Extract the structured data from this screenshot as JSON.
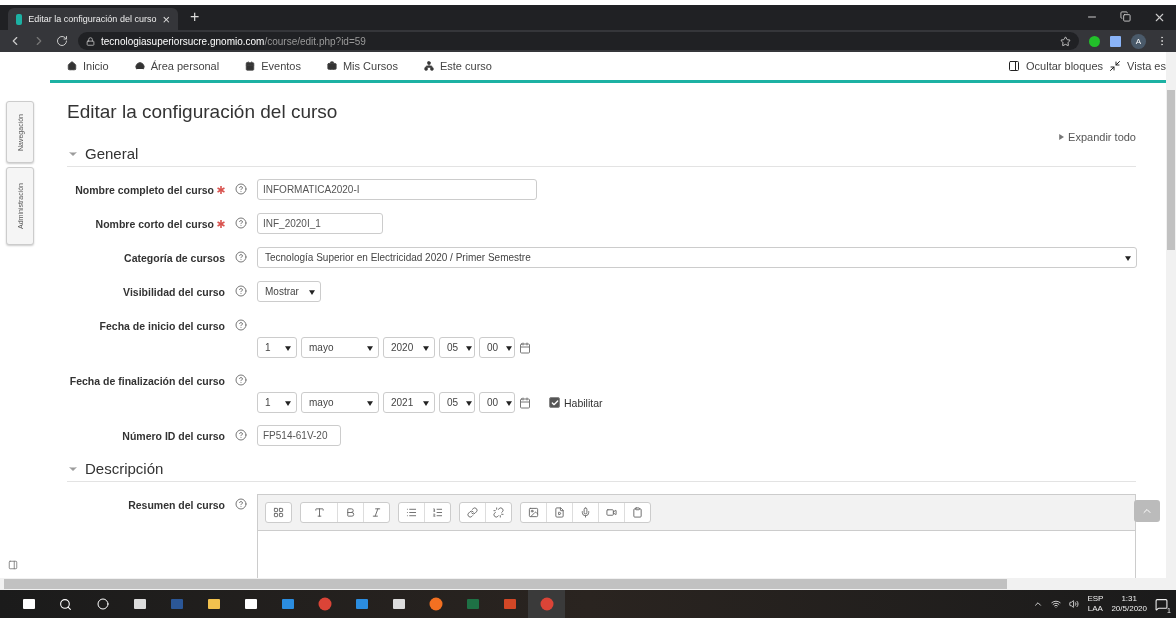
{
  "browser": {
    "tab_title": "Editar la configuración del curso",
    "tab_close": "×",
    "new_tab": "+",
    "host": "tecnologiasuperiorsucre.gnomio.com",
    "path": "/course/edit.php?id=59",
    "profile": "A"
  },
  "nav": {
    "items": [
      {
        "label": "Inicio"
      },
      {
        "label": "Área personal"
      },
      {
        "label": "Eventos"
      },
      {
        "label": "Mis Cursos"
      },
      {
        "label": "Este curso"
      }
    ],
    "right": [
      {
        "label": "Ocultar bloques"
      },
      {
        "label": "Vista es"
      }
    ]
  },
  "side_blocks": [
    "Navegación",
    "Administración"
  ],
  "page_title": "Editar la configuración del curso",
  "expand_all": "Expandir todo",
  "sections": [
    {
      "title": "General",
      "expanded": true,
      "fields": [
        {
          "kind": "text",
          "label": "Nombre completo del curso",
          "required": true,
          "value": "INFORMATICA2020-I"
        },
        {
          "kind": "text",
          "label": "Nombre corto del curso",
          "required": true,
          "value": "INF_2020I_1"
        },
        {
          "kind": "select",
          "label": "Categoría de cursos",
          "required": false,
          "value": "Tecnología Superior en Electricidad 2020 / Primer Semestre"
        },
        {
          "kind": "select",
          "label": "Visibilidad del curso",
          "required": false,
          "value": "Mostrar"
        },
        {
          "kind": "date",
          "label": "Fecha de inicio del curso",
          "required": false,
          "parts": [
            "1",
            "mayo",
            "2020",
            "05",
            "00"
          ]
        },
        {
          "kind": "date",
          "label": "Fecha de finalización del curso",
          "required": false,
          "parts": [
            "1",
            "mayo",
            "2021",
            "05",
            "00"
          ],
          "enable": {
            "label": "Habilitar",
            "checked": true
          }
        },
        {
          "kind": "text",
          "label": "Número ID del curso",
          "required": false,
          "value": "FP514-61V-20"
        }
      ]
    },
    {
      "title": "Descripción",
      "expanded": true,
      "fields": [
        {
          "kind": "editor",
          "label": "Resumen del curso",
          "required": false
        }
      ]
    }
  ],
  "taskbar": {
    "lang": "ESP",
    "layout": "LAA",
    "time": "1:31",
    "date": "20/5/2020",
    "notifications": "1"
  }
}
